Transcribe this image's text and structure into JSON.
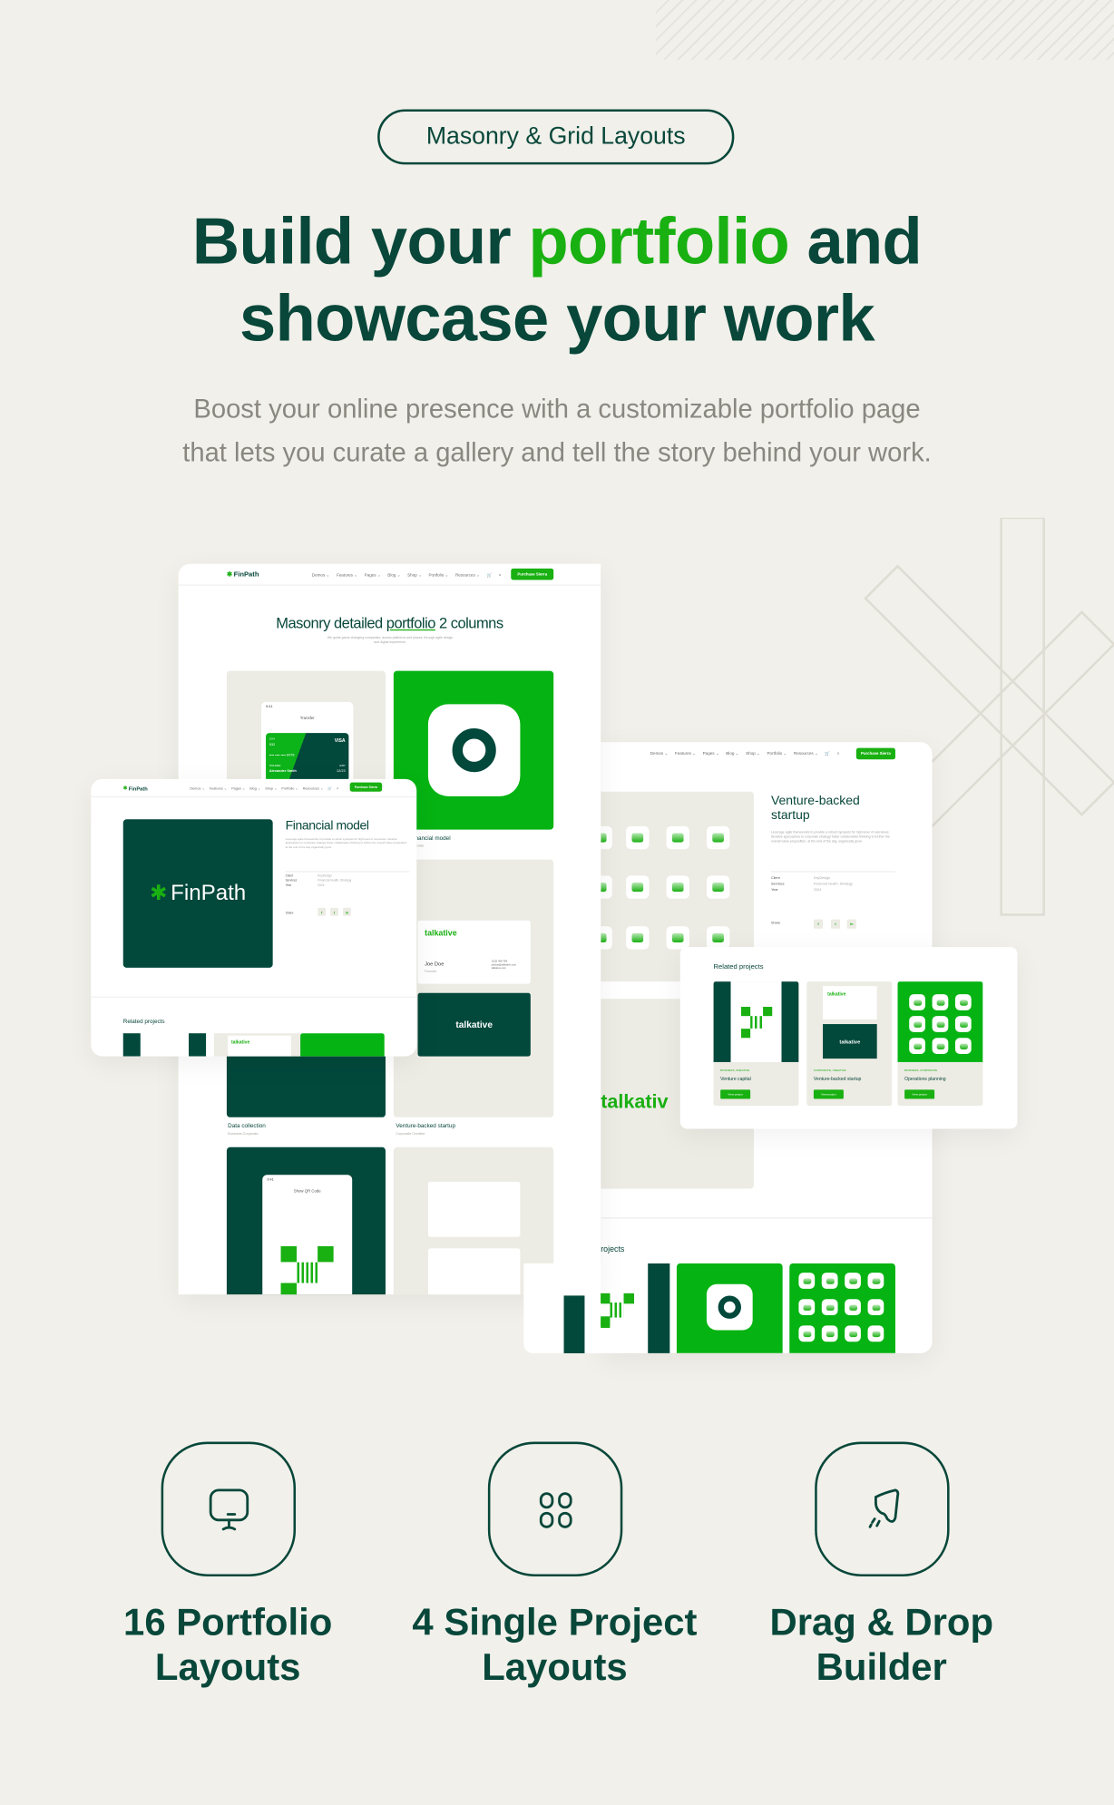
{
  "badge": "Masonry & Grid Layouts",
  "headline": {
    "part1": "Build your ",
    "accent": "portfolio",
    "part2": " and",
    "line2": "showcase your work"
  },
  "subtitle": {
    "line1": "Boost your online presence with a customizable portfolio page",
    "line2": "that lets you curate a gallery and tell the story behind your work."
  },
  "colors": {
    "dark_green": "#08473a",
    "accent_green": "#19b012",
    "background": "#f1f0ea"
  },
  "site_nav": {
    "logo": "FinPath",
    "items": [
      "Demos",
      "Features",
      "Pages",
      "Blog",
      "Shop",
      "Portfolio",
      "Resources"
    ],
    "cart_icon": "cart-icon",
    "search_icon": "search-icon",
    "button": "Purchase Sierra"
  },
  "masonry_page": {
    "title_pre": "Masonry detailed ",
    "title_link": "portfolio",
    "title_post": " 2 columns",
    "intro": "We guide game-changing companies, across platforms and places, through agile design and digital experience.",
    "phone": {
      "time": "9:41",
      "screen": "Transfer",
      "cvv_label": "CVV",
      "cvv": "532",
      "brand": "VISA",
      "number": "•••• •••• •••• 6478",
      "holder_label": "HOLDER",
      "holder": "Alexander Smith",
      "exp_label": "EXP",
      "exp": "12/23"
    },
    "items": [
      {
        "title": "Crypto financial model",
        "tags": "Business  Corporate"
      },
      {
        "title": "Data collection",
        "tags": "Business  Corporate"
      },
      {
        "title": "Venture-backed startup",
        "tags": "Corporate  Creative"
      }
    ],
    "business_card": {
      "brand": "talkative",
      "name": "Joe Doe",
      "role": "Founder",
      "contact": [
        "(123) 456-789",
        "joedoe@talkative.com",
        "talkative.com"
      ]
    },
    "qr_phone": {
      "time": "9:41",
      "screen": "Show QR Code"
    }
  },
  "financial_model": {
    "title": "Financial model",
    "description": "Leverage agile frameworks to provide a robust synopsis for high level of overviews. Iterative approaches to corporate strategy foster collaborative thinking to further the overall value proposition at the end of the day organically grow.",
    "meta": [
      {
        "label": "Client",
        "value": "KeyDesign"
      },
      {
        "label": "Services",
        "value": "Financial health, Strategy"
      },
      {
        "label": "Year",
        "value": "2024"
      }
    ],
    "share_label": "Share",
    "social": [
      "f",
      "t",
      "in"
    ],
    "related_title": "Related projects"
  },
  "venture_page": {
    "title": "Venture-backed startup",
    "description": "Leverage agile frameworks to provide a robust synopsis for high level of overviews. Iterative approaches to corporate strategy foster collaborative thinking to further the overall value proposition, at the end of the day, organically grow.",
    "meta": [
      {
        "label": "Client",
        "value": "KeyDesign"
      },
      {
        "label": "Services",
        "value": "Financial health, Strategy"
      },
      {
        "label": "Year",
        "value": "2024"
      }
    ],
    "share_label": "Share",
    "social": [
      "f",
      "t",
      "in"
    ],
    "big_brand": "talkativ",
    "related_partial": "rojects"
  },
  "related_projects": {
    "title": "Related projects",
    "cards": [
      {
        "category": "BUSINESS, CREATIVE",
        "title": "Venture capital",
        "button": "View project"
      },
      {
        "category": "CORPORATE, CREATIVE",
        "title": "Venture-backed startup",
        "button": "View project"
      },
      {
        "category": "BUSINESS, CORPORATE",
        "title": "Operations planning",
        "button": "View project"
      }
    ]
  },
  "features": [
    {
      "icon": "monitor-icon",
      "line1": "16 Portfolio",
      "line2": "Layouts"
    },
    {
      "icon": "grid-icon",
      "line1": "4 Single Project",
      "line2": "Layouts"
    },
    {
      "icon": "paint-brush-icon",
      "line1": "Drag & Drop",
      "line2": "Builder"
    }
  ]
}
